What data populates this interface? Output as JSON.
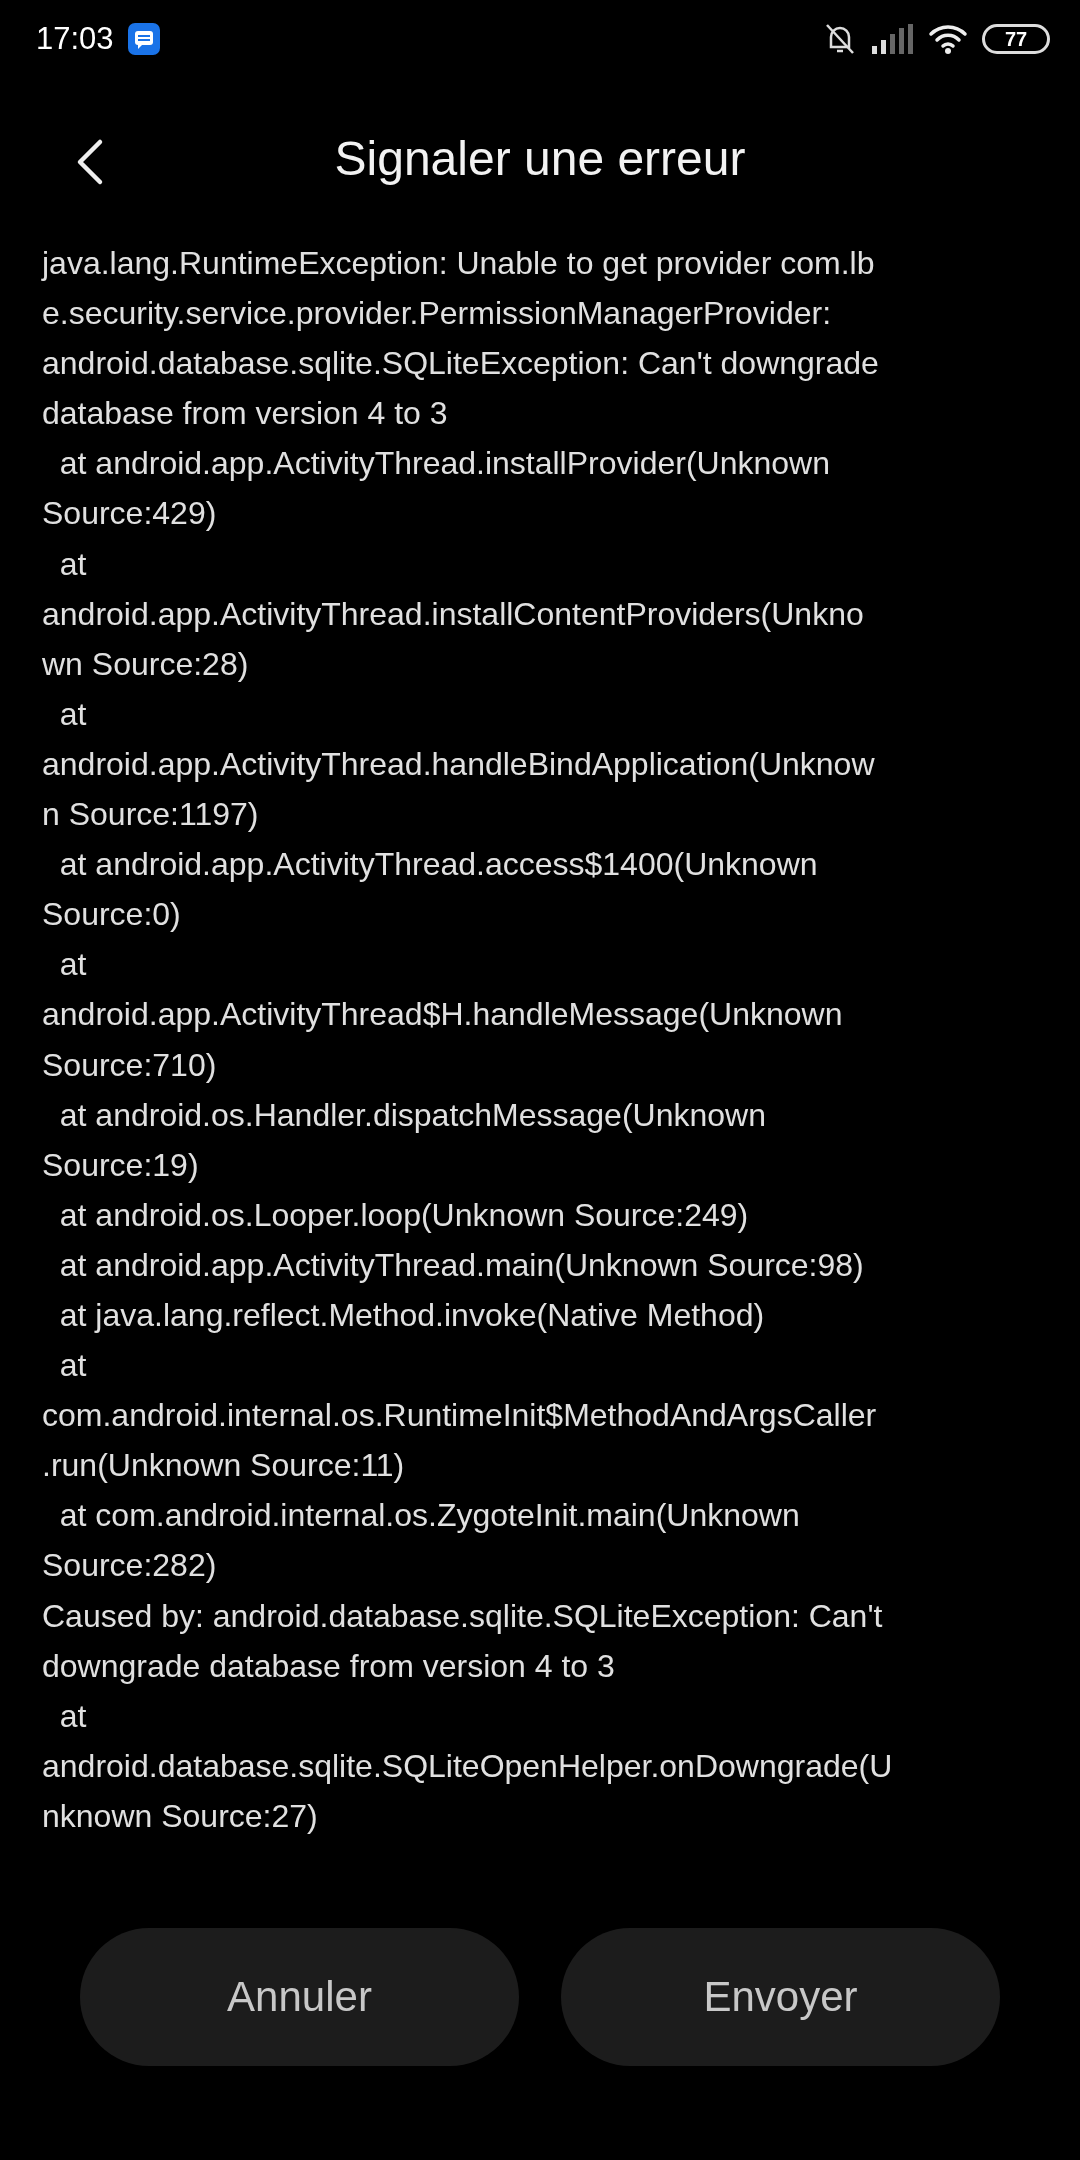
{
  "status_bar": {
    "time": "17:03",
    "battery": "77"
  },
  "header": {
    "title": "Signaler une erreur"
  },
  "log_lines": [
    "java.lang.RuntimeException: Unable to get provider com.lb",
    "e.security.service.provider.PermissionManagerProvider:",
    "android.database.sqlite.SQLiteException: Can't downgrade",
    "database from version 4 to 3",
    "  at android.app.ActivityThread.installProvider(Unknown",
    "Source:429)",
    "  at",
    "android.app.ActivityThread.installContentProviders(Unkno",
    "wn Source:28)",
    "  at",
    "android.app.ActivityThread.handleBindApplication(Unknow",
    "n Source:1197)",
    "  at android.app.ActivityThread.access$1400(Unknown",
    "Source:0)",
    "  at",
    "android.app.ActivityThread$H.handleMessage(Unknown",
    "Source:710)",
    "  at android.os.Handler.dispatchMessage(Unknown",
    "Source:19)",
    "  at android.os.Looper.loop(Unknown Source:249)",
    "  at android.app.ActivityThread.main(Unknown Source:98)",
    "  at java.lang.reflect.Method.invoke(Native Method)",
    "  at",
    "com.android.internal.os.RuntimeInit$MethodAndArgsCaller",
    ".run(Unknown Source:11)",
    "  at com.android.internal.os.ZygoteInit.main(Unknown",
    "Source:282)",
    "Caused by: android.database.sqlite.SQLiteException: Can't",
    "downgrade database from version 4 to 3",
    "  at",
    "android.database.sqlite.SQLiteOpenHelper.onDowngrade(U",
    "nknown Source:27)"
  ],
  "buttons": [
    "Annuler",
    "Envoyer"
  ]
}
